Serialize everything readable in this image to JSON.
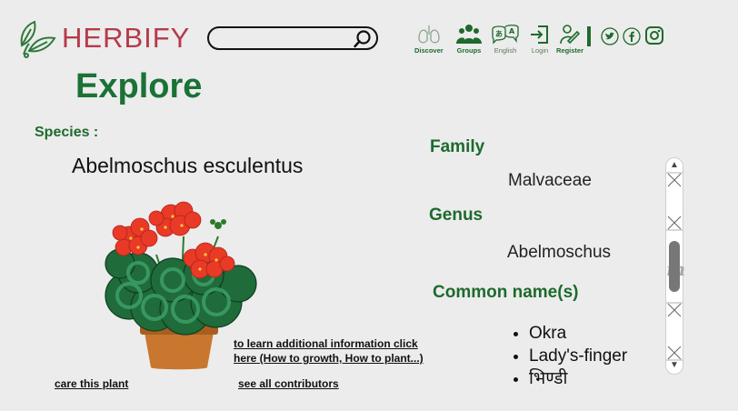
{
  "header": {
    "brand": "HERBIFY",
    "search": {
      "value": "",
      "placeholder": ""
    },
    "nav": [
      {
        "label": "Discover",
        "icon": "lungs-icon"
      },
      {
        "label": "Groups",
        "icon": "groups-icon"
      },
      {
        "label": "English",
        "icon": "translate-icon"
      },
      {
        "label": "Login",
        "icon": "login-icon"
      },
      {
        "label": "Register",
        "icon": "register-icon"
      }
    ],
    "social": [
      "twitter-icon",
      "facebook-icon",
      "instagram-icon"
    ]
  },
  "page": {
    "title": "Explore",
    "species_label": "Species :",
    "species": "Abelmoschus esculentus",
    "image_icon": "potted-plant",
    "more_info_link": "to learn additional information click here (How to growth, How to plant...)",
    "care_link": "care this plant",
    "contributors_link": "see all contributors"
  },
  "details": {
    "family_label": "Family",
    "family": "Malvaceae",
    "genus_label": "Genus",
    "genus": "Abelmoschus",
    "common_label": "Common name(s)",
    "common_names": [
      "Okra",
      "Lady's-finger",
      "भिण्डी"
    ]
  },
  "colors": {
    "brand": "#b53a4a",
    "accent": "#1e6a2e",
    "background": "#ececec"
  }
}
